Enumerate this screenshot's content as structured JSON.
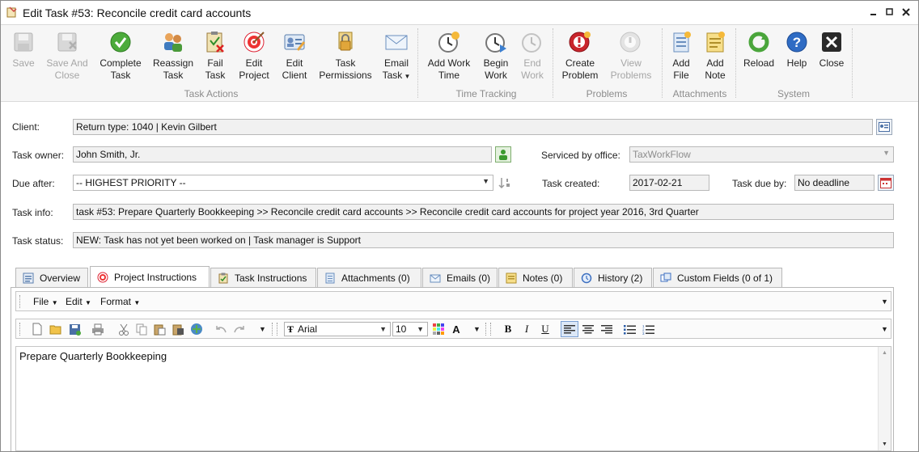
{
  "window": {
    "title": "Edit Task #53: Reconcile credit card accounts"
  },
  "ribbon": {
    "buttons": [
      {
        "label": "Save",
        "icon": "floppy-disk-icon",
        "enabled": false
      },
      {
        "label": "Save And\nClose",
        "icon": "floppy-disk-close-icon",
        "enabled": false
      },
      {
        "label": "Complete\nTask",
        "icon": "green-check-icon",
        "enabled": true
      },
      {
        "label": "Reassign\nTask",
        "icon": "users-icon",
        "enabled": true
      },
      {
        "label": "Fail\nTask",
        "icon": "fail-clipboard-icon",
        "enabled": true
      },
      {
        "label": "Edit\nProject",
        "icon": "target-icon",
        "enabled": true
      },
      {
        "label": "Edit\nClient",
        "icon": "client-card-icon",
        "enabled": true
      },
      {
        "label": "Task\nPermissions",
        "icon": "lock-icon",
        "enabled": true
      },
      {
        "label": "Email\nTask",
        "icon": "envelope-icon",
        "enabled": true
      },
      {
        "label": "Add Work\nTime",
        "icon": "clock-add-icon",
        "enabled": true
      },
      {
        "label": "Begin\nWork",
        "icon": "clock-play-icon",
        "enabled": true
      },
      {
        "label": "End\nWork",
        "icon": "clock-stop-icon",
        "enabled": false
      },
      {
        "label": "Create\nProblem",
        "icon": "problem-create-icon",
        "enabled": true
      },
      {
        "label": "View\nProblems",
        "icon": "problem-view-icon",
        "enabled": false
      },
      {
        "label": "Add\nFile",
        "icon": "add-file-icon",
        "enabled": true
      },
      {
        "label": "Add\nNote",
        "icon": "add-note-icon",
        "enabled": true
      },
      {
        "label": "Reload",
        "icon": "reload-icon",
        "enabled": true
      },
      {
        "label": "Help",
        "icon": "help-icon",
        "enabled": true
      },
      {
        "label": "Close",
        "icon": "close-icon",
        "enabled": true
      }
    ],
    "groups": [
      "Task Actions",
      "Time Tracking",
      "Problems",
      "Attachments",
      "System"
    ]
  },
  "form": {
    "client_label": "Client:",
    "client_value": "Return type: 1040 | Kevin Gilbert",
    "owner_label": "Task owner:",
    "owner_value": "John Smith, Jr.",
    "office_label": "Serviced by office:",
    "office_value": "TaxWorkFlow",
    "due_after_label": "Due after:",
    "due_after_value": "-- HIGHEST PRIORITY --",
    "created_label": "Task created:",
    "created_value": "2017-02-21",
    "due_by_label": "Task due by:",
    "due_by_value": "No deadline",
    "info_label": "Task info:",
    "info_value": "task #53: Prepare Quarterly Bookkeeping >> Reconcile credit card accounts >> Reconcile credit card accounts for project year 2016, 3rd Quarter",
    "status_label": "Task status:",
    "status_value": "NEW: Task has not yet been worked on | Task manager is Support"
  },
  "tabs": [
    {
      "label": "Overview",
      "icon": "overview-icon",
      "active": false
    },
    {
      "label": "Project Instructions",
      "icon": "target-icon",
      "active": true
    },
    {
      "label": "Task Instructions",
      "icon": "clipboard-icon",
      "active": false
    },
    {
      "label": "Attachments (0)",
      "icon": "attachments-icon",
      "active": false
    },
    {
      "label": "Emails (0)",
      "icon": "emails-icon",
      "active": false
    },
    {
      "label": "Notes (0)",
      "icon": "notes-icon",
      "active": false
    },
    {
      "label": "History (2)",
      "icon": "history-icon",
      "active": false
    },
    {
      "label": "Custom Fields (0 of 1)",
      "icon": "custom-fields-icon",
      "active": false
    }
  ],
  "editor": {
    "menus": [
      "File",
      "Edit",
      "Format"
    ],
    "font_name": "Arial",
    "font_size": "10",
    "content": "Prepare Quarterly Bookkeeping"
  }
}
